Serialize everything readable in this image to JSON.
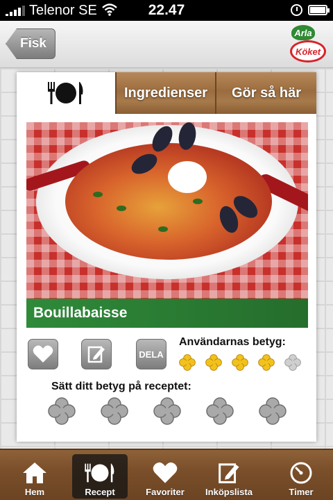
{
  "status_bar": {
    "carrier": "Telenor SE",
    "time": "22.47"
  },
  "nav": {
    "back_label": "Fisk",
    "logo_top": "Arla",
    "logo_bottom": "Köket"
  },
  "tabs": {
    "recipe_icon": "fork-plate-knife-icon",
    "ingredients_label": "Ingredienser",
    "instructions_label": "Gör så här"
  },
  "recipe": {
    "title": "Bouillabaisse"
  },
  "actions": {
    "share_label": "DELA"
  },
  "rating": {
    "users_label": "Användarnas betyg:",
    "users_value": 4,
    "users_max": 5,
    "set_label": "Sätt ditt betyg på receptet:",
    "my_value": 0,
    "my_max": 5
  },
  "tab_bar": {
    "items": [
      {
        "label": "Hem",
        "icon": "home-icon"
      },
      {
        "label": "Recept",
        "icon": "fork-plate-knife-icon"
      },
      {
        "label": "Favoriter",
        "icon": "heart-icon"
      },
      {
        "label": "Inköpslista",
        "icon": "notepad-pencil-icon"
      },
      {
        "label": "Timer",
        "icon": "timer-icon"
      }
    ],
    "active_index": 1
  },
  "colors": {
    "title_green": "#2f8a3a",
    "wood": "#9b6c3f",
    "star_yellow": "#f2c21c"
  }
}
